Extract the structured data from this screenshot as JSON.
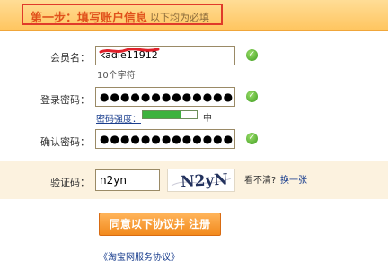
{
  "header": {
    "title": "第一步：填写账户信息",
    "note": "以下均为必填"
  },
  "username": {
    "label": "会员名：",
    "value": "kadie11912",
    "hint": "10个字符"
  },
  "password": {
    "label": "登录密码：",
    "value": "●●●●●●●●●●●●●●●",
    "strength_label": "密码强度：",
    "strength_level": 0.7,
    "strength_text": "中"
  },
  "confirm": {
    "label": "确认密码：",
    "value": "●●●●●●●●●●●●●●●"
  },
  "captcha": {
    "label": "验证码：",
    "value": "n2yn",
    "image_text": "N2yN",
    "unclear_text": "看不清?",
    "refresh_link": "换一张"
  },
  "submit_label": "同意以下协议并 注册",
  "agreement_link": "《淘宝网服务协议》",
  "colors": {
    "accent": "#f28a1d",
    "header_bg": "#ffc55f",
    "link": "#1b3f8f",
    "ok": "#3d9b1f",
    "highlight_border": "#e03a2a"
  }
}
